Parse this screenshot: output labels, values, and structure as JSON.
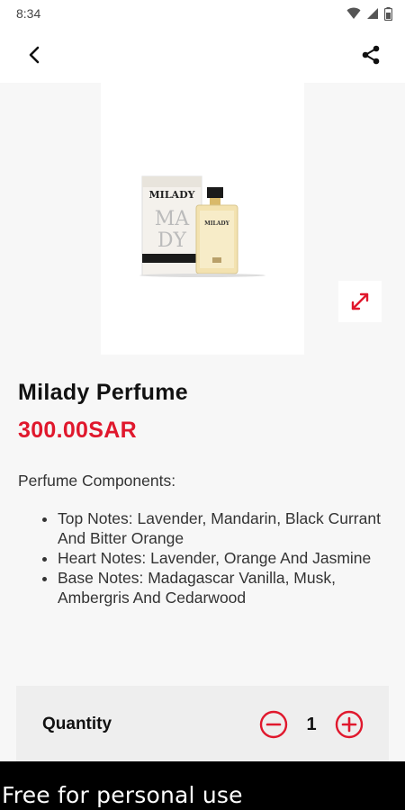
{
  "status_bar": {
    "time": "8:34",
    "icons": [
      "wifi-icon",
      "signal-icon",
      "battery-icon"
    ]
  },
  "app_bar": {
    "back_icon": "back-arrow-icon",
    "share_icon": "share-icon"
  },
  "product": {
    "image_label": "MILADY",
    "zoom_icon": "expand-icon",
    "title": "Milady Perfume",
    "price": "300.00SAR",
    "description_heading": "Perfume Components:",
    "notes": [
      "Top Notes: Lavender, Mandarin, Black Currant And Bitter Orange",
      "Heart Notes: Lavender, Orange And Jasmine",
      "Base Notes: Madagascar Vanilla, Musk, Ambergris And Cedarwood"
    ]
  },
  "quantity": {
    "label": "Quantity",
    "value": "1",
    "minus_icon": "minus-circle-icon",
    "plus_icon": "plus-circle-icon"
  },
  "watermark": "Free for personal use",
  "colors": {
    "accent": "#e0182d",
    "panel": "#eeeeee",
    "background": "#f7f7f7"
  }
}
